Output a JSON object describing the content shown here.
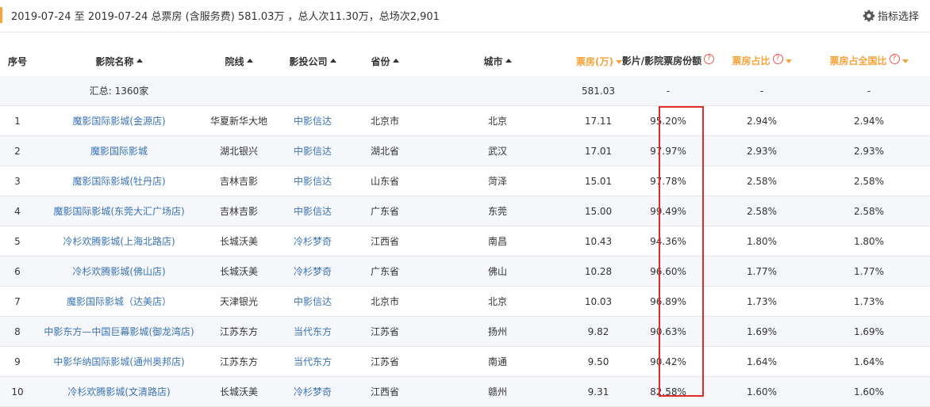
{
  "header": {
    "summary": "2019-07-24 至 2019-07-24 总票房 (含服务费) 581.03万 ，总人次11.30万，总场次2,901",
    "indicator_button": "指标选择",
    "accent_color": "#f7a33a"
  },
  "columns": {
    "seq": "序号",
    "cinema": "影院名称",
    "line": "院线",
    "company": "影投公司",
    "province": "省份",
    "city": "城市",
    "boxoffice": "票房(万)",
    "share": "影片/影院票房份额",
    "ratio": "票房占比",
    "national_ratio": "票房占全国比"
  },
  "summary_row": {
    "label": "汇总: 1360家",
    "boxoffice": "581.03",
    "share": "-",
    "ratio": "-",
    "national_ratio": "-"
  },
  "rows": [
    {
      "seq": "1",
      "cinema": "魔影国际影城(金源店)",
      "line": "华夏新华大地",
      "company": "中影信达",
      "province": "北京市",
      "city": "北京",
      "boxoffice": "17.11",
      "share": "95.20%",
      "ratio": "2.94%",
      "national_ratio": "2.94%"
    },
    {
      "seq": "2",
      "cinema": "魔影国际影城",
      "line": "湖北银兴",
      "company": "中影信达",
      "province": "湖北省",
      "city": "武汉",
      "boxoffice": "17.01",
      "share": "97.97%",
      "ratio": "2.93%",
      "national_ratio": "2.93%"
    },
    {
      "seq": "3",
      "cinema": "魔影国际影城(牡丹店)",
      "line": "吉林吉影",
      "company": "中影信达",
      "province": "山东省",
      "city": "菏泽",
      "boxoffice": "15.01",
      "share": "97.78%",
      "ratio": "2.58%",
      "national_ratio": "2.58%"
    },
    {
      "seq": "4",
      "cinema": "魔影国际影城(东莞大汇广场店)",
      "line": "吉林吉影",
      "company": "中影信达",
      "province": "广东省",
      "city": "东莞",
      "boxoffice": "15.00",
      "share": "99.49%",
      "ratio": "2.58%",
      "national_ratio": "2.58%"
    },
    {
      "seq": "5",
      "cinema": "冷杉欢腾影城(上海北路店)",
      "line": "长城沃美",
      "company": "冷杉梦奇",
      "province": "江西省",
      "city": "南昌",
      "boxoffice": "10.43",
      "share": "94.36%",
      "ratio": "1.80%",
      "national_ratio": "1.80%"
    },
    {
      "seq": "6",
      "cinema": "冷杉欢腾影城(佛山店)",
      "line": "长城沃美",
      "company": "冷杉梦奇",
      "province": "广东省",
      "city": "佛山",
      "boxoffice": "10.28",
      "share": "96.60%",
      "ratio": "1.77%",
      "national_ratio": "1.77%"
    },
    {
      "seq": "7",
      "cinema": "魔影国际影城（达美店）",
      "line": "天津银光",
      "company": "中影信达",
      "province": "北京市",
      "city": "北京",
      "boxoffice": "10.03",
      "share": "96.89%",
      "ratio": "1.73%",
      "national_ratio": "1.73%"
    },
    {
      "seq": "8",
      "cinema": "中影东方—中国巨幕影城(御龙湾店)",
      "line": "江苏东方",
      "company": "当代东方",
      "province": "江苏省",
      "city": "扬州",
      "boxoffice": "9.82",
      "share": "90.63%",
      "ratio": "1.69%",
      "national_ratio": "1.69%"
    },
    {
      "seq": "9",
      "cinema": "中影华纳国际影城(通州奥邦店)",
      "line": "江苏东方",
      "company": "当代东方",
      "province": "江苏省",
      "city": "南通",
      "boxoffice": "9.50",
      "share": "90.42%",
      "ratio": "1.64%",
      "national_ratio": "1.64%"
    },
    {
      "seq": "10",
      "cinema": "冷杉欢腾影城(文清路店)",
      "line": "长城沃美",
      "company": "冷杉梦奇",
      "province": "江西省",
      "city": "赣州",
      "boxoffice": "9.31",
      "share": "82.58%",
      "ratio": "1.60%",
      "national_ratio": "1.60%"
    }
  ],
  "icons": {
    "settings": "gear-icon",
    "help": "question-circle-icon",
    "sort": "sort-arrow-icon"
  },
  "colors": {
    "link": "#3a73b3",
    "highlight_border": "#e02b2b",
    "help": "#e85858",
    "alt_row": "#f5f7fa"
  }
}
